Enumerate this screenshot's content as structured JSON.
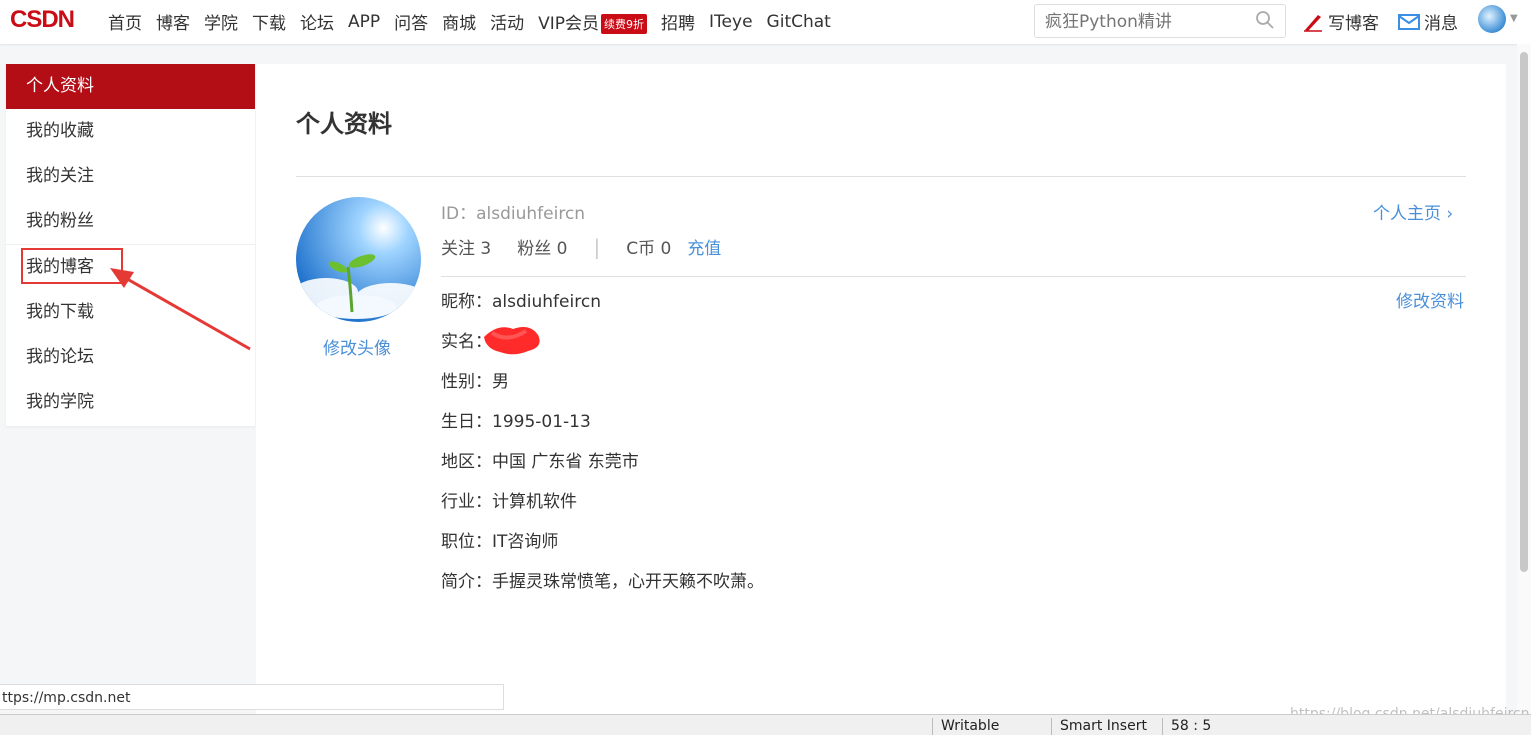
{
  "brand": {
    "logo": "CSDN"
  },
  "nav": {
    "items": [
      "首页",
      "博客",
      "学院",
      "下载",
      "论坛",
      "APP",
      "问答",
      "商城",
      "活动",
      "VIP会员"
    ],
    "vip_badge": "续费9折",
    "items_after": [
      "招聘",
      "ITeye",
      "GitChat"
    ]
  },
  "search": {
    "placeholder": "疯狂Python精讲",
    "icon": "search-icon"
  },
  "header_actions": {
    "write": "写博客",
    "messages": "消息"
  },
  "sidebar": {
    "items": [
      {
        "label": "个人资料",
        "active": true
      },
      {
        "label": "我的收藏"
      },
      {
        "label": "我的关注"
      },
      {
        "label": "我的粉丝"
      },
      {
        "label": "我的博客"
      },
      {
        "label": "我的下载"
      },
      {
        "label": "我的论坛"
      },
      {
        "label": "我的学院"
      }
    ]
  },
  "profile": {
    "title": "个人资料",
    "id_line": "ID：alsdiuhfeircn",
    "follow": "关注 3",
    "fans": "粉丝 0",
    "coins": "C币 0",
    "recharge": "充值",
    "home_link": "个人主页",
    "edit_avatar": "修改头像",
    "edit_profile": "修改资料",
    "fields": [
      "昵称：alsdiuhfeircn",
      "实名：",
      "性别：男",
      "生日：1995-01-13",
      "地区：中国 广东省 东莞市",
      "行业：计算机软件",
      "职位：IT咨询师",
      "简介：手握灵珠常愤笔，心开天籁不吹萧。"
    ]
  },
  "statusbar": {
    "url": "ttps://mp.csdn.net",
    "writable": "Writable",
    "insert": "Smart Insert",
    "position": "58 : 5",
    "watermark": "https://blog.csdn.net/alsdiuhfeircn"
  },
  "colors": {
    "brand_red": "#ca0c16",
    "active_red": "#b30d16",
    "link_blue": "#4a90d9"
  }
}
